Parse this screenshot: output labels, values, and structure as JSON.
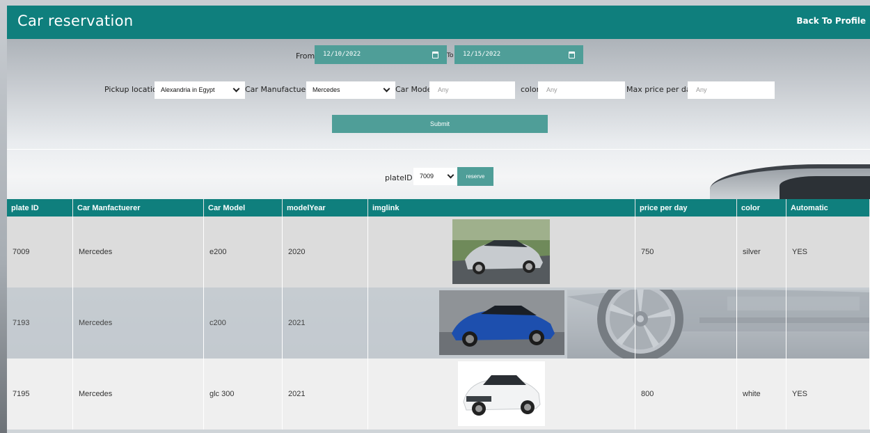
{
  "header": {
    "title": "Car reservation",
    "back_link": "Back To Profile"
  },
  "dates": {
    "from_label": "From",
    "from_value": "12/10/2022",
    "to_label": "To",
    "to_value": "12/15/2022"
  },
  "filters": {
    "pickup_label": "Pickup location",
    "pickup_value": "Alexandria in Egypt",
    "manufacturer_label": "Car Manufactuerer",
    "manufacturer_value": "Mercedes",
    "model_label": "Car Model",
    "model_placeholder": "Any",
    "color_label": "color",
    "color_placeholder": "Any",
    "maxprice_label": "Max price per day",
    "maxprice_placeholder": "Any"
  },
  "submit_label": "Submit",
  "reserve": {
    "label": "plateID",
    "selected": "7009",
    "button": "reserve"
  },
  "table": {
    "headers": [
      "plate ID",
      "Car Manfactuerer",
      "Car Model",
      "modelYear",
      "imglink",
      "price per day",
      "color",
      "Automatic"
    ],
    "rows": [
      {
        "plate": "7009",
        "manufacturer": "Mercedes",
        "model": "e200",
        "year": "2020",
        "price": "750",
        "color": "silver",
        "automatic": "YES"
      },
      {
        "plate": "7193",
        "manufacturer": "Mercedes",
        "model": "c200",
        "year": "2021",
        "price": "",
        "color": "",
        "automatic": ""
      },
      {
        "plate": "7195",
        "manufacturer": "Mercedes",
        "model": "glc 300",
        "year": "2021",
        "price": "800",
        "color": "white",
        "automatic": "YES"
      }
    ]
  },
  "colors": {
    "teal": "#0f7f7d",
    "button": "#4f9e98"
  }
}
